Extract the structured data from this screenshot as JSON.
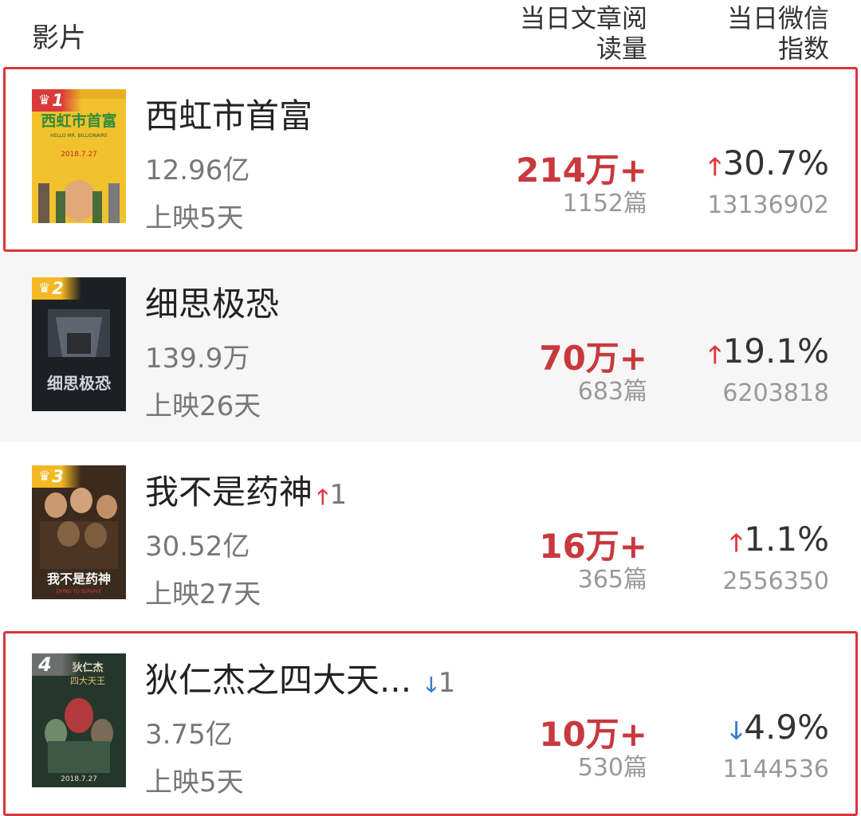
{
  "header": {
    "film": "影片",
    "read_col": [
      "当日文章阅",
      "读量"
    ],
    "wechat_col": [
      "当日微信",
      "指数"
    ]
  },
  "movies": [
    {
      "rank": "1",
      "title": "西虹市首富",
      "rank_change": "",
      "rank_dir": "",
      "gross": "12.96亿",
      "days": "上映5天",
      "reads": "214万+",
      "articles": "1152篇",
      "wx_dir": "up",
      "wx_pct": "30.7%",
      "wx_index": "13136902",
      "poster_text": [
        "西虹市首富",
        "HELLO MR. BILLIONAIRE",
        "2018.7.27"
      ]
    },
    {
      "rank": "2",
      "title": "细思极恐",
      "rank_change": "",
      "rank_dir": "",
      "gross": "139.9万",
      "days": "上映26天",
      "reads": "70万+",
      "articles": "683篇",
      "wx_dir": "up",
      "wx_pct": "19.1%",
      "wx_index": "6203818",
      "poster_text": [
        "细思极恐"
      ]
    },
    {
      "rank": "3",
      "title": "我不是药神",
      "rank_change": "1",
      "rank_dir": "up",
      "gross": "30.52亿",
      "days": "上映27天",
      "reads": "16万+",
      "articles": "365篇",
      "wx_dir": "up",
      "wx_pct": "1.1%",
      "wx_index": "2556350",
      "poster_text": [
        "我不是药神",
        "DYING TO SURVIVE"
      ]
    },
    {
      "rank": "4",
      "title": "狄仁杰之四大天...",
      "rank_change": "1",
      "rank_dir": "down",
      "gross": "3.75亿",
      "days": "上映5天",
      "reads": "10万+",
      "articles": "530篇",
      "wx_dir": "down",
      "wx_pct": "4.9%",
      "wx_index": "1144536",
      "poster_text": [
        "狄仁杰",
        "四大天王",
        "2018.7.27"
      ]
    }
  ],
  "icons": {
    "rank_badge": "crown-icon",
    "up": "arrow-up-icon",
    "down": "arrow-down-icon"
  },
  "colors": {
    "highlight_border": "#d9353d",
    "reads": "#c8393e",
    "up": "#e0353b",
    "down": "#3b78d8",
    "badge_red": "#d93b3b",
    "badge_gold": "#f3b823"
  }
}
